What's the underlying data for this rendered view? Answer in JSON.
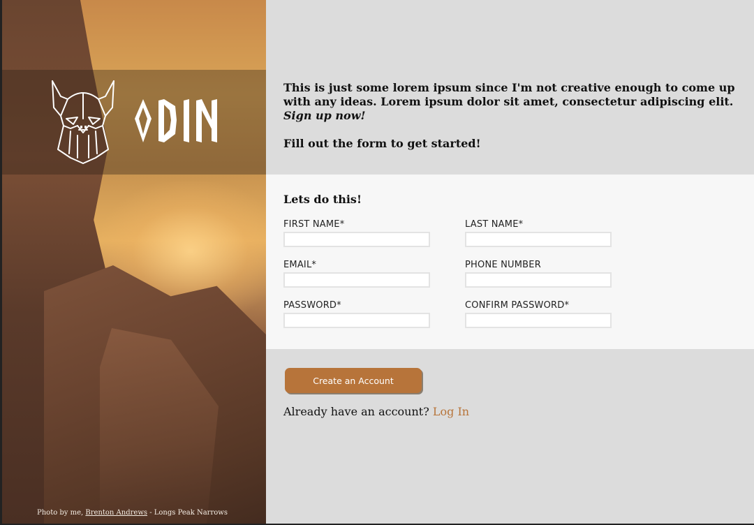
{
  "brand": {
    "name": "ODIN",
    "icon": "viking-helmet-icon"
  },
  "photo_credit": {
    "prefix": "Photo by me, ",
    "author": "Brenton Andrews",
    "suffix": " - Longs Peak Narrows"
  },
  "intro": {
    "text": "This is just some lorem ipsum since I'm not creative enough to come up with any ideas. Lorem ipsum dolor sit amet, consectetur adipiscing elit.",
    "cta": "Sign up now!",
    "fill_prompt": "Fill out the form to get started!"
  },
  "form": {
    "heading": "Lets do this!",
    "fields": {
      "first_name": {
        "label": "FIRST NAME*",
        "value": ""
      },
      "last_name": {
        "label": "LAST NAME*",
        "value": ""
      },
      "email": {
        "label": "EMAIL*",
        "value": ""
      },
      "phone": {
        "label": "PHONE NUMBER",
        "value": ""
      },
      "password": {
        "label": "PASSWORD*",
        "value": ""
      },
      "confirm_password": {
        "label": "CONFIRM PASSWORD*",
        "value": ""
      }
    }
  },
  "actions": {
    "create_label": "Create an Account",
    "login_prompt": "Already have an account? ",
    "login_link": "Log In"
  },
  "colors": {
    "accent": "#b7743a",
    "panel_bg": "#dcdcdc",
    "form_bg": "#f7f7f7"
  }
}
